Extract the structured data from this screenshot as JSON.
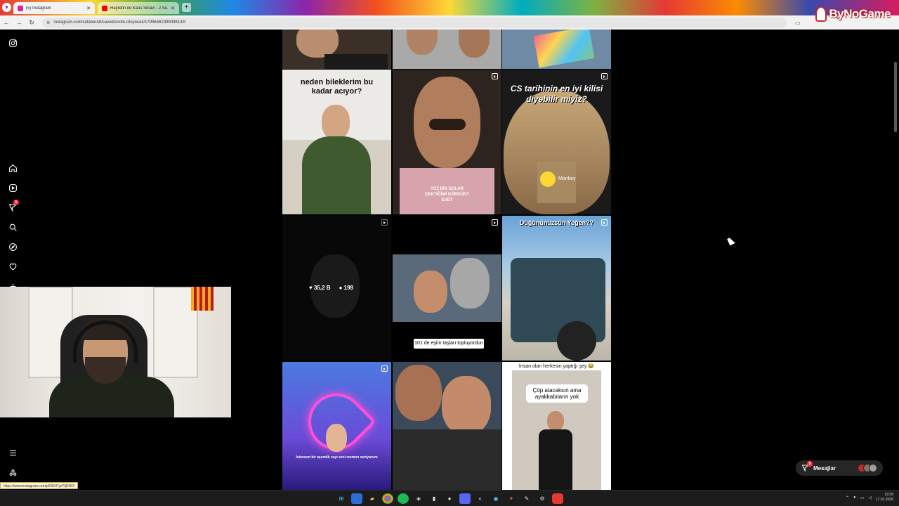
{
  "browser": {
    "tabs": [
      {
        "title": "(5) Instagram",
        "active": true,
        "favicon_color": "#d6249f"
      },
      {
        "title": "Hayretin ile Kaos Sinavi - 2 Su...",
        "active": false,
        "favicon_color": "#ff0000"
      }
    ],
    "url": "instagram.com/sefaberatt/saved/cnobi-izleyecek/17996462399098133/",
    "brand": "ByNoGame",
    "status_url": "https://www.instagram.com/p/DENTg4YjDNO/"
  },
  "sidebar": {
    "notification_badge": "5",
    "items": [
      {
        "icon": "instagram-icon"
      },
      {
        "icon": "home-icon"
      },
      {
        "icon": "reels-icon"
      },
      {
        "icon": "messages-icon"
      },
      {
        "icon": "search-icon"
      },
      {
        "icon": "explore-icon"
      },
      {
        "icon": "heart-icon"
      },
      {
        "icon": "create-icon"
      },
      {
        "icon": "more-icon"
      },
      {
        "icon": "threads-icon"
      }
    ]
  },
  "feed": {
    "posts": [
      {
        "caption": "",
        "reel": false
      },
      {
        "caption": "",
        "reel": false
      },
      {
        "caption": "",
        "reel": false
      },
      {
        "caption": "neden bileklerim bu kadar acıyor?",
        "reel": false
      },
      {
        "caption": "YÜZ BİN DOLAR ÇEKTİĞİMİ GÖRDÜN? EVET",
        "reel": true
      },
      {
        "caption": "CS tarihinin en iyi kilisi diyebilir miyiz?",
        "sub": "Monkey",
        "reel": true
      },
      {
        "caption": "",
        "likes": "35,2 B",
        "comments": "198",
        "reel": true
      },
      {
        "caption": "101 de eşim taşları topluyordun",
        "reel": true
      },
      {
        "caption": "Düğününüzsün Yeğen??",
        "reel": true
      },
      {
        "caption": "İstersem bir aşemlik sayı seni resmen seviyorum",
        "reel": true
      },
      {
        "caption": "",
        "reel": false
      },
      {
        "caption": "İnsan olan herkesin yaptığı şey 😂",
        "sub": "Çöp atacaksın ama ayakkabıların yok",
        "reel": false
      }
    ]
  },
  "messages": {
    "label": "Mesajlar",
    "badge": "5"
  },
  "taskbar": {
    "time": "23:35",
    "date": "17.01.2026"
  }
}
